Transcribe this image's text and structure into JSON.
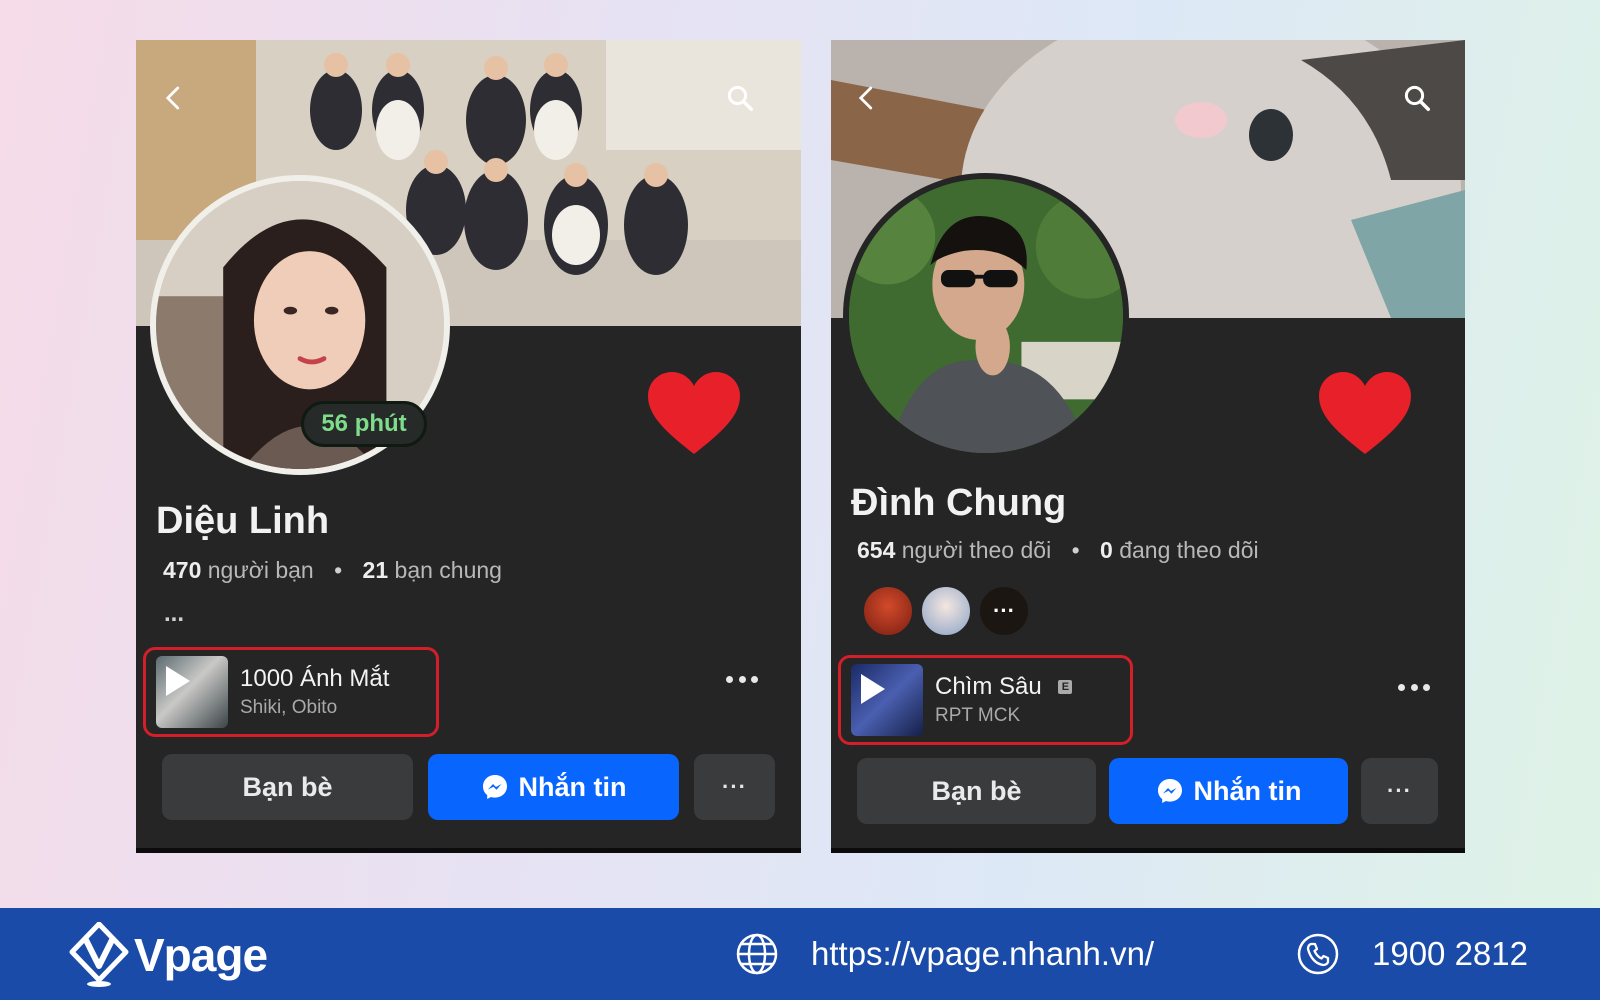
{
  "profiles": [
    {
      "name": "Diệu Linh",
      "status_pill": "56 phút",
      "stats": {
        "count1": "470",
        "label1": "người bạn",
        "count2": "21",
        "label2": "bạn chung"
      },
      "ellipsis": "...",
      "music": {
        "title": "1000 Ánh Mắt",
        "artist": "Shiki, Obito",
        "explicit": ""
      },
      "buttons": {
        "friends": "Bạn bè",
        "message": "Nhắn tin",
        "more": "···"
      }
    },
    {
      "name": "Đình Chung",
      "stats": {
        "count1": "654",
        "label1": "người theo dõi",
        "count2": "0",
        "label2": "đang theo dõi"
      },
      "mutual_more": "···",
      "music": {
        "title": "Chìm Sâu",
        "artist": "RPT MCK",
        "explicit": "E"
      },
      "buttons": {
        "friends": "Bạn bè",
        "message": "Nhắn tin",
        "more": "···"
      }
    }
  ],
  "separator": "•",
  "footer": {
    "brand": "Vpage",
    "website": "https://vpage.nhanh.vn/",
    "phone": "1900 2812"
  },
  "colors": {
    "card_bg": "#252526",
    "messenger_blue": "#0866ff",
    "heart_red": "#e8202a",
    "highlight_red": "#d21f2a",
    "footer_blue": "#1b4ba8",
    "status_green": "#7edc8a"
  },
  "icons": [
    "back-arrow-icon",
    "search-icon",
    "heart-icon",
    "play-icon",
    "messenger-icon",
    "globe-icon",
    "phone-icon",
    "vpage-logo-icon"
  ]
}
